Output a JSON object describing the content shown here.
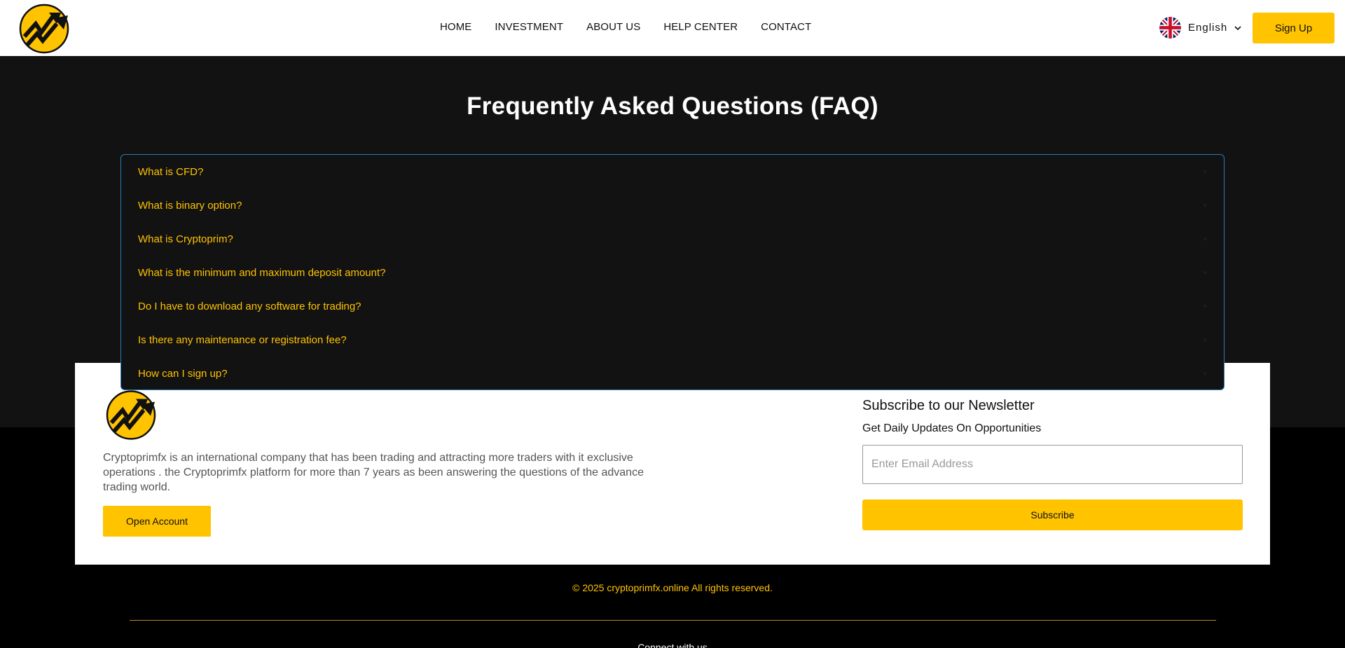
{
  "header": {
    "nav": [
      "HOME",
      "INVESTMENT",
      "ABOUT US",
      "HELP CENTER",
      "CONTACT"
    ],
    "language": "English",
    "signup_label": "Sign Up"
  },
  "faq": {
    "title": "Frequently Asked Questions (FAQ)",
    "items": [
      "What is CFD?",
      "What is binary option?",
      "What is Cryptoprim?",
      "What is the minimum and maximum deposit amount?",
      "Do I have to download any software for trading?",
      "Is there any maintenance or registration fee?",
      "How can I sign up?"
    ]
  },
  "footer": {
    "description": "Cryptoprimfx is an international company that has been trading and attracting more traders with it exclusive operations . the Cryptoprimfx platform for more than 7 years as been answering the questions of the advance trading world.",
    "open_account_label": "Open Account",
    "newsletter_title": "Subscribe to our Newsletter",
    "newsletter_subtitle": "Get Daily Updates On Opportunities",
    "email_placeholder": "Enter Email Address",
    "subscribe_label": "Subscribe",
    "copyright": "© 2025 cryptoprimfx.online All rights reserved.",
    "connect": "Connect with us"
  },
  "colors": {
    "accent": "#ffc300",
    "dark_bg": "#121212",
    "faq_border": "#2a7cb8"
  }
}
